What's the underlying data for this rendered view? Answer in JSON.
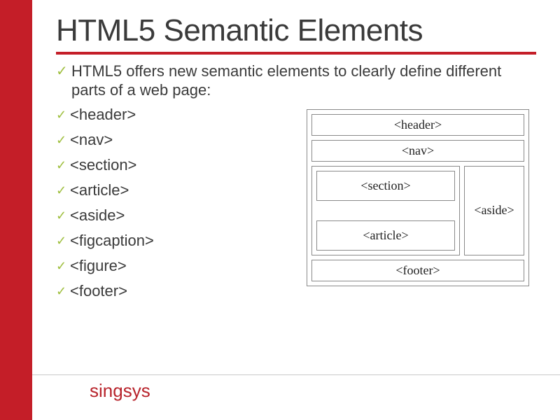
{
  "title": "HTML5 Semantic Elements",
  "lead": "HTML5 offers new semantic elements to clearly define different parts of a web page:",
  "tags": [
    "<header>",
    "<nav>",
    "<section>",
    "<article>",
    "<aside>",
    "<figcaption>",
    "<figure>",
    "<footer>"
  ],
  "diagram": {
    "header": "<header>",
    "nav": "<nav>",
    "section": "<section>",
    "article": "<article>",
    "aside": "<aside>",
    "footer": "<footer>"
  },
  "brand": "singsys",
  "colors": {
    "accent": "#c41e28",
    "check": "#9fbf3f"
  }
}
